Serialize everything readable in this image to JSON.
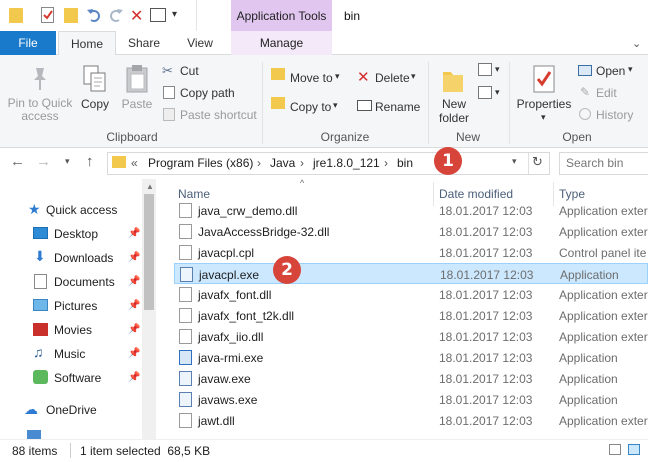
{
  "window": {
    "title": "bin",
    "context_tab_title": "Application Tools"
  },
  "ribbon_tabs": {
    "file": "File",
    "home": "Home",
    "share": "Share",
    "view": "View",
    "manage": "Manage"
  },
  "ribbon": {
    "clipboard": {
      "pin": "Pin to Quick access",
      "pin_line1": "Pin to Quick",
      "pin_line2": "access",
      "copy": "Copy",
      "paste": "Paste",
      "cut": "Cut",
      "copy_path": "Copy path",
      "paste_shortcut": "Paste shortcut",
      "label": "Clipboard"
    },
    "organize": {
      "move_to": "Move to",
      "copy_to": "Copy to",
      "delete": "Delete",
      "rename": "Rename",
      "label": "Organize"
    },
    "new": {
      "new_folder_line1": "New",
      "new_folder_line2": "folder",
      "label": "New"
    },
    "open": {
      "properties": "Properties",
      "open": "Open",
      "edit": "Edit",
      "history": "History",
      "label": "Open"
    }
  },
  "address": {
    "overflow": "«",
    "crumbs": [
      "Program Files (x86)",
      "Java",
      "jre1.8.0_121",
      "bin"
    ],
    "search_placeholder": "Search bin"
  },
  "nav": {
    "items": [
      {
        "label": "Quick access",
        "icon": "star-icon",
        "pinned": false
      },
      {
        "label": "Desktop",
        "icon": "desktop-icon",
        "pinned": true
      },
      {
        "label": "Downloads",
        "icon": "downloads-icon",
        "pinned": true
      },
      {
        "label": "Documents",
        "icon": "documents-icon",
        "pinned": true
      },
      {
        "label": "Pictures",
        "icon": "pictures-icon",
        "pinned": true
      },
      {
        "label": "Movies",
        "icon": "movies-icon",
        "pinned": true
      },
      {
        "label": "Music",
        "icon": "music-icon",
        "pinned": true
      },
      {
        "label": "Software",
        "icon": "software-icon",
        "pinned": true
      },
      {
        "label": "OneDrive",
        "icon": "onedrive-icon",
        "pinned": false
      }
    ]
  },
  "columns": {
    "name": "Name",
    "date": "Date modified",
    "type": "Type"
  },
  "files": [
    {
      "name": "java_crw_demo.dll",
      "date": "18.01.2017 12:03",
      "type": "Application exter",
      "icon": "dll-icon"
    },
    {
      "name": "JavaAccessBridge-32.dll",
      "date": "18.01.2017 12:03",
      "type": "Application exter",
      "icon": "dll-icon"
    },
    {
      "name": "javacpl.cpl",
      "date": "18.01.2017 12:03",
      "type": "Control panel ite",
      "icon": "cpl-icon"
    },
    {
      "name": "javacpl.exe",
      "date": "18.01.2017 12:03",
      "type": "Application",
      "icon": "java-exe-icon",
      "selected": true
    },
    {
      "name": "javafx_font.dll",
      "date": "18.01.2017 12:03",
      "type": "Application exter",
      "icon": "dll-icon"
    },
    {
      "name": "javafx_font_t2k.dll",
      "date": "18.01.2017 12:03",
      "type": "Application exter",
      "icon": "dll-icon"
    },
    {
      "name": "javafx_iio.dll",
      "date": "18.01.2017 12:03",
      "type": "Application exter",
      "icon": "dll-icon"
    },
    {
      "name": "java-rmi.exe",
      "date": "18.01.2017 12:03",
      "type": "Application",
      "icon": "exe-icon"
    },
    {
      "name": "javaw.exe",
      "date": "18.01.2017 12:03",
      "type": "Application",
      "icon": "java-exe-icon"
    },
    {
      "name": "javaws.exe",
      "date": "18.01.2017 12:03",
      "type": "Application",
      "icon": "java-exe-icon"
    },
    {
      "name": "jawt.dll",
      "date": "18.01.2017 12:03",
      "type": "Application exter",
      "icon": "dll-icon"
    }
  ],
  "status": {
    "count": "88 items",
    "selection": "1 item selected  68,5 KB"
  },
  "annotations": {
    "badge1": "1",
    "badge2": "2"
  },
  "colors": {
    "file_tab": "#1979ca",
    "context_tab": "#e1c6f0",
    "selection": "#cce8ff",
    "badge": "#d6443a"
  }
}
